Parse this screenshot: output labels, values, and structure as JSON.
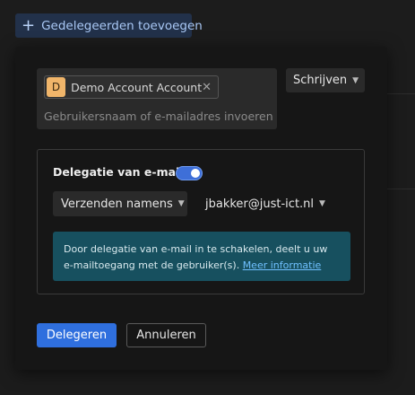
{
  "header": {
    "add_delegate_label": "Gedelegeerden toevoegen",
    "add_icon": "plus-icon"
  },
  "recipient": {
    "chip": {
      "avatar_initial": "D",
      "label": "Demo Account Account",
      "close_icon": "close-icon"
    },
    "placeholder": "Gebruikersnaam of e-mailadres invoeren",
    "value": ""
  },
  "permission": {
    "selected": "Schrijven",
    "chevron_icon": "chevron-down-icon"
  },
  "email_delegation": {
    "title": "Delegatie van e-mail",
    "enabled": true,
    "send_as": {
      "selected": "Verzenden namens"
    },
    "account": {
      "selected": "jbakker@just-ict.nl"
    },
    "info_text": "Door delegatie van e-mail in te schakelen, deelt u uw e-mailtoegang met de gebruiker(s). ",
    "info_link": "Meer informatie"
  },
  "actions": {
    "primary_label": "Delegeren",
    "secondary_label": "Annuleren"
  },
  "colors": {
    "accent": "#2f6fde",
    "toggle_on": "#3e6fd8",
    "info_background": "#17505f",
    "link": "#6fc0ff",
    "chip_avatar": "#f0b56a"
  }
}
